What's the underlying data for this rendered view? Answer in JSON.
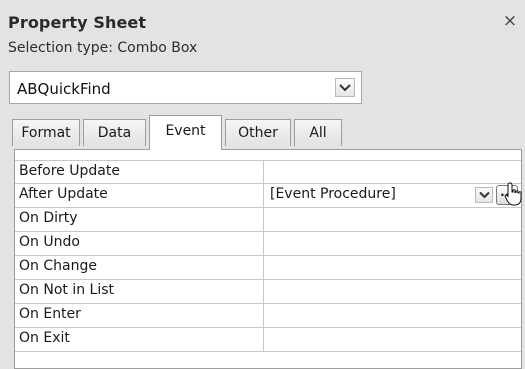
{
  "panel": {
    "title": "Property Sheet",
    "close_glyph": "×",
    "selection_type": "Selection type: Combo Box"
  },
  "combo": {
    "value": "ABQuickFind",
    "icon": "chevron-down-icon"
  },
  "tabs": [
    {
      "label": "Format",
      "active": false
    },
    {
      "label": "Data",
      "active": false
    },
    {
      "label": "Event",
      "active": true
    },
    {
      "label": "Other",
      "active": false
    },
    {
      "label": "All",
      "active": false
    }
  ],
  "rows": [
    {
      "label": "Before Update",
      "value": ""
    },
    {
      "label": "After Update",
      "value": "[Event Procedure]"
    },
    {
      "label": "On Dirty",
      "value": ""
    },
    {
      "label": "On Undo",
      "value": ""
    },
    {
      "label": "On Change",
      "value": ""
    },
    {
      "label": "On Not in List",
      "value": ""
    },
    {
      "label": "On Enter",
      "value": ""
    },
    {
      "label": "On Exit",
      "value": ""
    }
  ],
  "build_button": {
    "label": "..."
  }
}
